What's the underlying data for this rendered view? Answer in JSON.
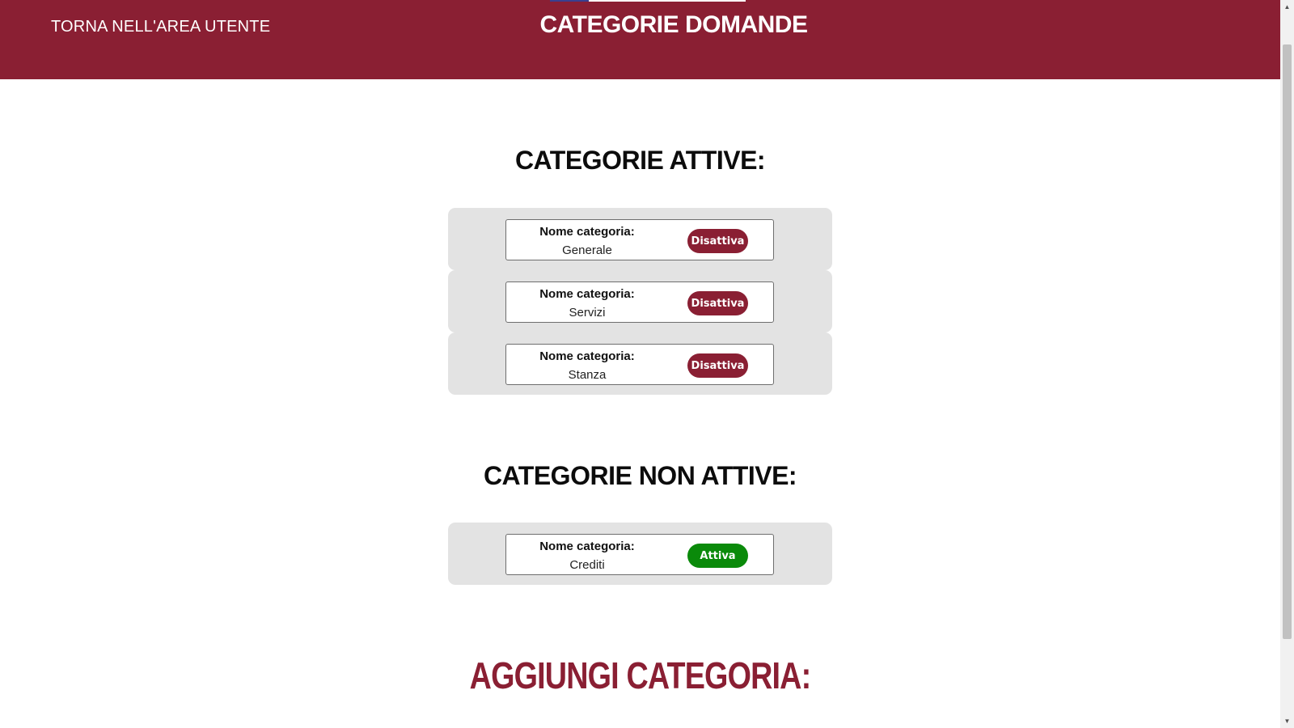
{
  "header": {
    "back_link": "TORNA NELL'AREA UTENTE",
    "title": "CATEGORIE DOMANDE"
  },
  "active_section": {
    "title": "CATEGORIE ATTIVE:",
    "items": [
      {
        "label": "Nome categoria:",
        "name": "Generale",
        "button": "Disattiva"
      },
      {
        "label": "Nome categoria:",
        "name": "Servizi",
        "button": "Disattiva"
      },
      {
        "label": "Nome categoria:",
        "name": "Stanza",
        "button": "Disattiva"
      }
    ]
  },
  "inactive_section": {
    "title": "CATEGORIE NON ATTIVE:",
    "items": [
      {
        "label": "Nome categoria:",
        "name": "Crediti",
        "button": "Attiva"
      }
    ]
  },
  "add_section": {
    "title": "AGGIUNGI CATEGORIA:"
  },
  "colors": {
    "brand": "#8a1f33",
    "activate": "#0a8a0a",
    "row_background": "#e3e3e3"
  },
  "icons": {
    "scroll_up": "triangle-up-icon",
    "scroll_down": "triangle-down-icon"
  }
}
